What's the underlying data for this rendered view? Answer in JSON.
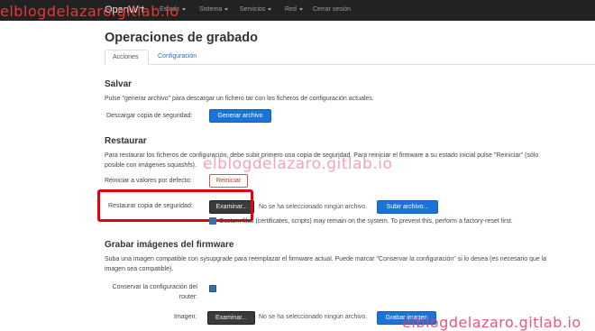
{
  "navbar": {
    "brand": "OpenWrt",
    "items": [
      {
        "label": "Estado",
        "dropdown": true
      },
      {
        "label": "Sistema",
        "dropdown": true
      },
      {
        "label": "Servicios",
        "dropdown": true
      },
      {
        "label": "Red",
        "dropdown": true
      },
      {
        "label": "Cerrar sesión",
        "dropdown": false
      }
    ]
  },
  "watermark": {
    "top": "elblogdelazaro.gitlab.io",
    "middle": "elblogdelazaro.gitlab.io",
    "bottom": "elblogdelazaro.gitlab.io"
  },
  "page": {
    "title": "Operaciones de grabado",
    "tabs": [
      {
        "label": "Acciones",
        "active": true
      },
      {
        "label": "Configuración",
        "active": false
      }
    ]
  },
  "salvar": {
    "title": "Salvar",
    "description": "Pulse \"generar archivo\" para descargar un fichero tar con los ficheros de configuración actuales.",
    "download_label": "Descargar copia de seguridad:",
    "generate_button": "Generar archivo"
  },
  "restaurar": {
    "title": "Restaurar",
    "description_line1": "Para restaurar los ficheros de configuración, debe subir primero una copia de seguridad. Para reiniciar el firmware a su estado inicial pulse \"Reiniciar\" (sólo",
    "description_line2": "posible con imágenes squashfs).",
    "reset_label": "Reiniciar a valores por defecto:",
    "reset_button": "Reiniciar",
    "restore_label": "Restaurar copia de seguridad:",
    "browse_button": "Examinar...",
    "file_status": "No se ha seleccionado ningún archivo.",
    "upload_button": "Subir archivo...",
    "info_text": "Custom files (certificates, scripts) may remain on the system. To prevent this, perform a factory-reset first."
  },
  "firmware": {
    "title": "Grabar imágenes del firmware",
    "description_line1": "Suba una imagen compatible con sysupgrade para reemplazar el firmware actual. Puede marcar \"Conservar la configuración\" si lo desea (es necesario que la",
    "description_line2": "imagen sea compatible).",
    "keep_label_line1": "Conservar la configuración del",
    "keep_label_line2": "router:",
    "keep_checked": true,
    "image_label": "Imagen:",
    "browse_button": "Examinar...",
    "file_status": "No se ha seleccionado ningún archivo.",
    "flash_button": "Grabar imagen"
  }
}
